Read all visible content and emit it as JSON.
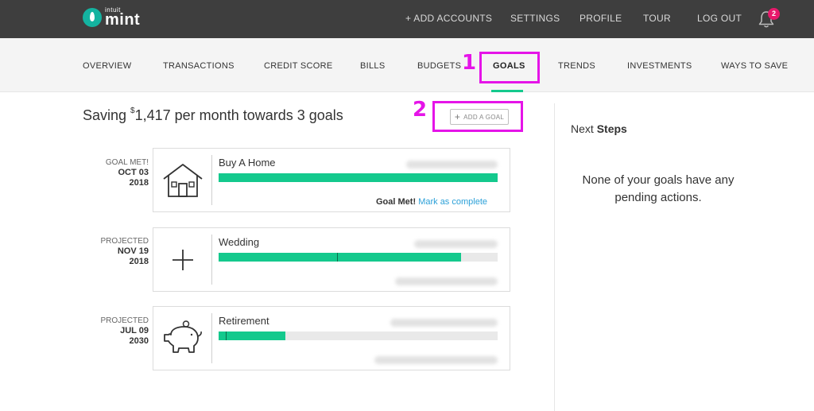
{
  "header": {
    "logo_small": "intuit",
    "logo_main": "mint",
    "nav": [
      "+ ADD ACCOUNTS",
      "SETTINGS",
      "PROFILE",
      "TOUR",
      "LOG OUT"
    ],
    "notification_count": "2"
  },
  "subnav": {
    "items": [
      "OVERVIEW",
      "TRANSACTIONS",
      "CREDIT SCORE",
      "BILLS",
      "BUDGETS",
      "GOALS",
      "TRENDS",
      "INVESTMENTS",
      "WAYS TO SAVE"
    ],
    "active": "GOALS"
  },
  "annotations": {
    "one": "1",
    "two": "2"
  },
  "summary": {
    "prefix": "Saving ",
    "currency": "$",
    "amount": "1,417",
    "middle": " per month towards ",
    "count": "3",
    "suffix": " goals"
  },
  "add_goal": {
    "label": "ADD A GOAL"
  },
  "goals": [
    {
      "status": "GOAL MET!",
      "month_day": "OCT 03",
      "year": "2018",
      "name": "Buy A Home",
      "progress": 1.0,
      "marker": null,
      "icon": "house-icon",
      "met_label": "Goal Met!",
      "complete_link": "Mark as complete"
    },
    {
      "status": "PROJECTED",
      "month_day": "NOV 19",
      "year": "2018",
      "name": "Wedding",
      "progress": 0.87,
      "marker": 0.425,
      "icon": "plus-icon"
    },
    {
      "status": "PROJECTED",
      "month_day": "JUL 09",
      "year": "2030",
      "name": "Retirement",
      "progress": 0.24,
      "marker": 0.025,
      "icon": "piggy-bank-icon"
    }
  ],
  "right_panel": {
    "title_plain": "Next ",
    "title_bold": "Steps",
    "message": "None of your goals have any pending actions."
  },
  "colors": {
    "topbar": "#3e3e3e",
    "accent_green": "#14c98d",
    "link_blue": "#2ba0d8",
    "annotation_magenta": "#e514e8",
    "badge_pink": "#e8196b",
    "logo_teal": "#14b3a0"
  }
}
